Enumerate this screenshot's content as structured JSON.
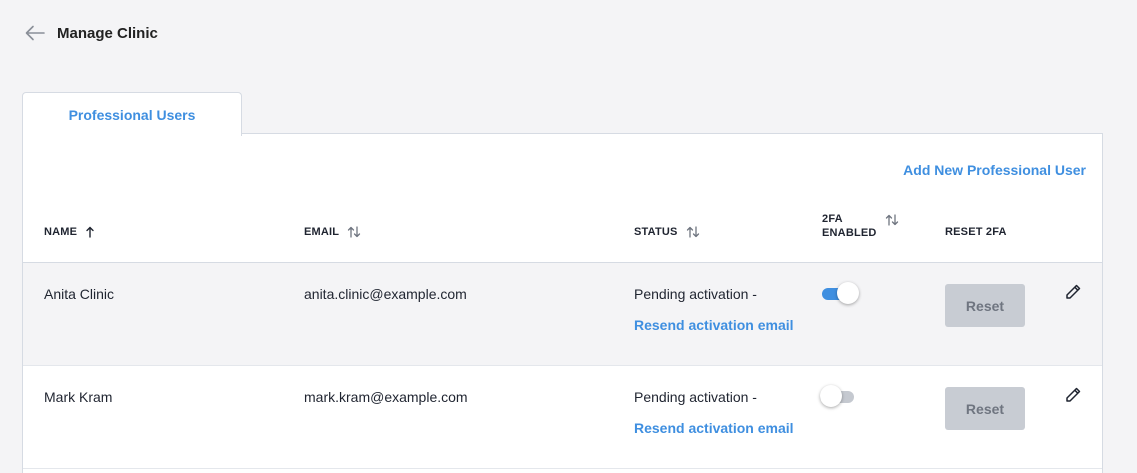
{
  "header": {
    "title": "Manage Clinic",
    "back_icon": "arrow-left-icon"
  },
  "tabs": [
    {
      "label": "Professional Users",
      "active": true
    }
  ],
  "actions": {
    "add_user": "Add New Professional User"
  },
  "table": {
    "columns": [
      {
        "key": "name",
        "label": "NAME",
        "sort": "ascending"
      },
      {
        "key": "email",
        "label": "EMAIL",
        "sort": "none"
      },
      {
        "key": "status",
        "label": "STATUS",
        "sort": "none"
      },
      {
        "key": "twofa",
        "label_line1": "2FA",
        "label_line2": "ENABLED",
        "sort": "none"
      },
      {
        "key": "reset",
        "label": "RESET 2FA"
      }
    ],
    "rows": [
      {
        "name": "Anita Clinic",
        "email": "anita.clinic@example.com",
        "status": "Pending activation -",
        "resend": "Resend activation email",
        "twofa_enabled": true,
        "reset_label": "Reset"
      },
      {
        "name": "Mark Kram",
        "email": "mark.kram@example.com",
        "status": "Pending activation -",
        "resend": "Resend activation email",
        "twofa_enabled": false,
        "reset_label": "Reset"
      }
    ]
  },
  "colors": {
    "accent": "#3f8fe0",
    "disabled_button": "#c8ccd3",
    "background": "#f4f4f6"
  }
}
